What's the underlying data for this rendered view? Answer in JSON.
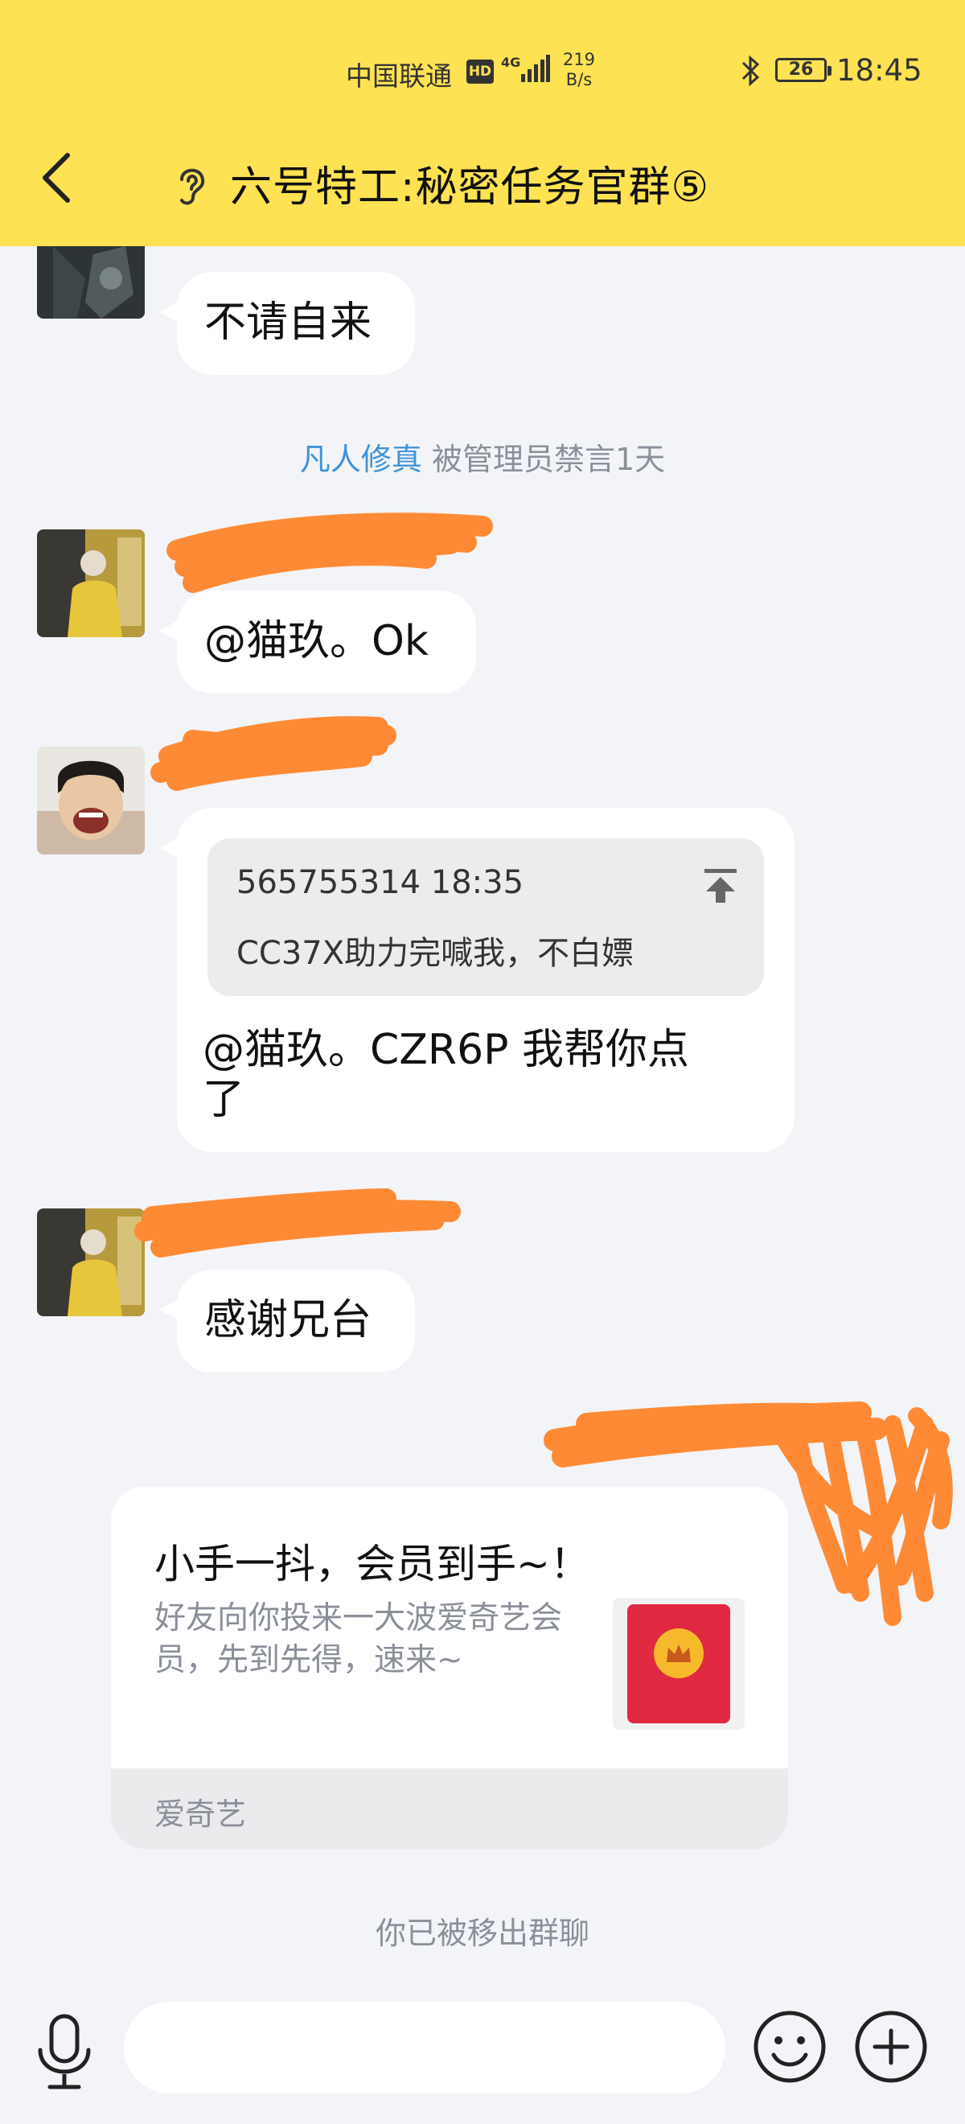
{
  "status_bar": {
    "carrier": "中国联通",
    "hd": "HD",
    "network": "4G",
    "speed_value": "219",
    "speed_unit": "B/s",
    "battery": "26",
    "time": "18:45"
  },
  "header": {
    "title": "六号特工:秘密任务官群⑤",
    "back_icon": "back-arrow-icon",
    "mode_icon": "ear-icon"
  },
  "messages": [
    {
      "text": "不请自来"
    },
    {
      "text": "@猫玖。Ok"
    },
    {
      "quote": {
        "meta": "565755314 18:35",
        "text": "CC37X助力完喊我，不白嫖"
      },
      "line1": "@猫玖。CZR6P 我帮你点",
      "line2": "了"
    },
    {
      "text": "感谢兄台"
    }
  ],
  "system": {
    "mute_user": "凡人修真",
    "mute_text": " 被管理员禁言1天",
    "removed": "你已被移出群聊"
  },
  "card": {
    "title": "小手一抖，会员到手~！",
    "desc": "好友向你投来一大波爱奇艺会员，先到先得，速来~",
    "source": "爱奇艺"
  },
  "input": {
    "placeholder": "",
    "mic_icon": "microphone-icon",
    "emoji_icon": "emoji-icon",
    "plus_icon": "plus-icon"
  },
  "colors": {
    "header_bg": "#fde253",
    "page_bg": "#f3f4f8",
    "link": "#3f94d8",
    "scribble": "#ff8a35",
    "red_packet": "#e02840"
  }
}
